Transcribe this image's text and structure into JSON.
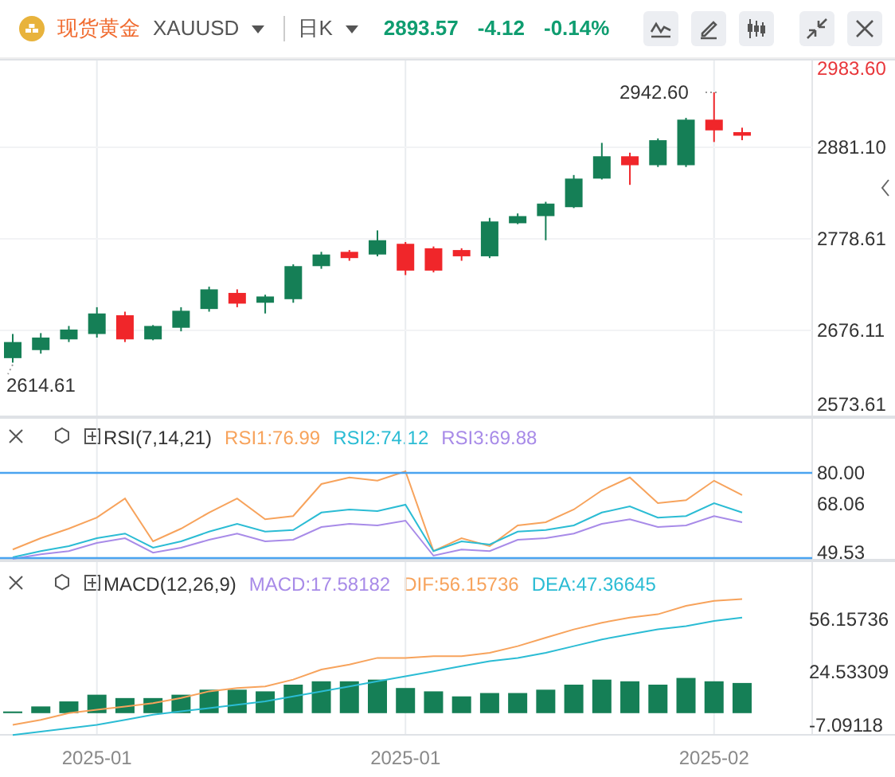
{
  "header": {
    "name": "现货黄金",
    "symbol": "XAUUSD",
    "period": "日K",
    "price": "2893.57",
    "change": "-4.12",
    "change_pct": "-0.14%"
  },
  "main_chart": {
    "top_label": "2983.60",
    "bottom_label": "2573.61",
    "high_label": "2942.60",
    "low_label": "2614.61",
    "chart_data": {
      "type": "candlestick",
      "grid": true,
      "categories": [
        null,
        null,
        null,
        null,
        null,
        null,
        null,
        null,
        null,
        null,
        null,
        null,
        null,
        null,
        null,
        null,
        null,
        null,
        null,
        null,
        null,
        null,
        null,
        null,
        null,
        null,
        null
      ],
      "ylim": [
        2578.9,
        2980.0
      ],
      "yticks": [
        {
          "value": 2881.1,
          "label": "2881.10"
        },
        {
          "value": 2778.61,
          "label": "2778.61"
        },
        {
          "value": 2676.11,
          "label": "2676.11"
        }
      ],
      "ohlc": [
        [
          2645,
          2672,
          2640,
          2663
        ],
        [
          2654,
          2673,
          2650,
          2668
        ],
        [
          2666,
          2681,
          2663,
          2677
        ],
        [
          2672,
          2702,
          2668,
          2695
        ],
        [
          2693,
          2697,
          2663,
          2666
        ],
        [
          2666,
          2682,
          2665,
          2681
        ],
        [
          2679,
          2702,
          2675,
          2698
        ],
        [
          2700,
          2725,
          2697,
          2722
        ],
        [
          2718,
          2722,
          2702,
          2706
        ],
        [
          2707,
          2716,
          2695,
          2714
        ],
        [
          2711,
          2750,
          2707,
          2748
        ],
        [
          2748,
          2764,
          2745,
          2761
        ],
        [
          2764,
          2766,
          2754,
          2757
        ],
        [
          2761,
          2788,
          2759,
          2777
        ],
        [
          2773,
          2775,
          2738,
          2743
        ],
        [
          2768,
          2770,
          2741,
          2743
        ],
        [
          2766,
          2768,
          2754,
          2759
        ],
        [
          2759,
          2802,
          2757,
          2798
        ],
        [
          2796,
          2807,
          2795,
          2804
        ],
        [
          2804,
          2820,
          2777,
          2818
        ],
        [
          2814,
          2850,
          2813,
          2846
        ],
        [
          2846,
          2886,
          2845,
          2871
        ],
        [
          2871,
          2875,
          2839,
          2861
        ],
        [
          2861,
          2891,
          2859,
          2889
        ],
        [
          2861,
          2914,
          2859,
          2912
        ],
        [
          2912,
          2942.6,
          2887,
          2900
        ],
        [
          2898,
          2903,
          2889,
          2894
        ]
      ]
    }
  },
  "rsi": {
    "title": "RSI(7,14,21)",
    "values": [
      {
        "text": "RSI1:76.99",
        "color": "#f7a35c"
      },
      {
        "text": "RSI2:74.12",
        "color": "#2bbcd4"
      },
      {
        "text": "RSI3:69.88",
        "color": "#a88be8"
      }
    ],
    "chart_data": {
      "type": "line",
      "grid": true,
      "categories": [
        null,
        null,
        null,
        null,
        null,
        null,
        null,
        null,
        null,
        null,
        null,
        null,
        null,
        null,
        null,
        null,
        null,
        null,
        null,
        null,
        null,
        null,
        null,
        null,
        null,
        null,
        null
      ],
      "ylim": [
        46.5,
        101.3
      ],
      "yticks": [
        {
          "value": 80,
          "label": "80.00"
        },
        {
          "value": 68.06,
          "label": "68.06"
        },
        {
          "value": 49.53,
          "label": "49.53"
        }
      ],
      "series": [
        {
          "color": "#f7a35c",
          "values": [
            50.7,
            55.0,
            58.7,
            62.9,
            70.2,
            53.8,
            58.7,
            64.8,
            70.2,
            62.3,
            63.5,
            75.7,
            78.2,
            77.0,
            80.6,
            50.1,
            55.0,
            52.0,
            59.9,
            61.1,
            66.0,
            73.3,
            78.2,
            68.4,
            69.6,
            77.0,
            71.5
          ]
        },
        {
          "color": "#2bbcd4",
          "values": [
            47.7,
            50.1,
            52.0,
            55.0,
            56.8,
            51.4,
            53.8,
            57.5,
            60.5,
            57.5,
            58.1,
            64.8,
            66.0,
            65.4,
            67.8,
            50.1,
            53.8,
            52.6,
            57.5,
            58.1,
            59.9,
            64.8,
            67.2,
            62.9,
            63.5,
            68.4,
            64.8
          ]
        },
        {
          "color": "#a88be8",
          "values": [
            47.1,
            48.9,
            50.1,
            53.2,
            55.0,
            49.5,
            51.4,
            54.4,
            56.8,
            53.8,
            54.4,
            59.3,
            60.5,
            59.9,
            61.7,
            48.3,
            50.7,
            50.1,
            54.4,
            55.0,
            56.8,
            60.5,
            62.3,
            59.3,
            59.9,
            63.5,
            61.1
          ]
        }
      ]
    }
  },
  "macd": {
    "title": "MACD(12,26,9)",
    "values": [
      {
        "text": "MACD:17.58182",
        "color": "#a88be8"
      },
      {
        "text": "DIF:56.15736",
        "color": "#f7a35c"
      },
      {
        "text": "DEA:47.36645",
        "color": "#2bbcd4"
      }
    ],
    "chart_data": {
      "type": "bar",
      "grid": true,
      "categories": [
        null,
        null,
        null,
        "2025-01",
        null,
        null,
        null,
        null,
        null,
        null,
        null,
        null,
        null,
        null,
        "2025-01",
        null,
        null,
        null,
        null,
        null,
        null,
        null,
        null,
        null,
        null,
        "2025-02",
        null
      ],
      "ylim": [
        -13.4,
        91.1
      ],
      "yticks": [
        {
          "value": 56.15736,
          "label": "56.15736"
        },
        {
          "value": 24.53309,
          "label": "24.53309"
        },
        {
          "value": -7.09118,
          "label": "-7.09118"
        }
      ],
      "series": [
        {
          "color": "#157f56",
          "values": [
            1,
            4,
            7,
            11,
            9,
            9,
            11,
            14,
            14,
            13,
            17,
            19,
            19,
            20,
            15,
            13,
            10,
            12,
            12,
            14,
            17,
            20,
            19,
            17,
            21,
            19,
            18
          ]
        },
        {
          "type": "line",
          "color": "#f7a35c",
          "values": [
            -7,
            -4,
            0,
            2,
            4,
            6,
            9,
            13,
            15,
            16,
            20,
            26,
            29,
            33,
            33,
            34,
            34,
            36,
            40,
            45,
            50,
            54,
            57,
            59,
            64,
            67,
            68
          ]
        },
        {
          "type": "line",
          "color": "#2bbcd4",
          "values": [
            -13,
            -11,
            -9,
            -7,
            -4,
            -1,
            1,
            3,
            5,
            7,
            10,
            13,
            16,
            19,
            22,
            25,
            28,
            31,
            33,
            36,
            40,
            44,
            47,
            50,
            52,
            55,
            57
          ]
        }
      ]
    }
  }
}
